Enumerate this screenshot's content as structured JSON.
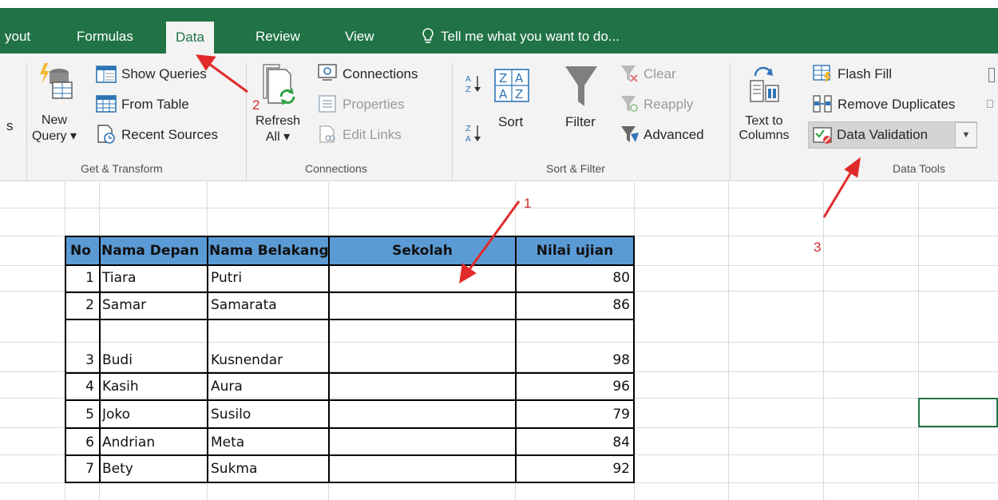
{
  "tabs": [
    {
      "label": "yout",
      "active": false
    },
    {
      "label": "Formulas",
      "active": false
    },
    {
      "label": "Data",
      "active": true
    },
    {
      "label": "Review",
      "active": false
    },
    {
      "label": "View",
      "active": false
    }
  ],
  "tell_me": "Tell me what you want to do...",
  "ribbon": {
    "get_transform": {
      "label": "Get & Transform",
      "partial_label": "s",
      "new_query": [
        "New",
        "Query"
      ],
      "show_queries": "Show Queries",
      "from_table": "From Table",
      "recent_sources": "Recent Sources"
    },
    "connections": {
      "label": "Connections",
      "refresh_all": [
        "Refresh",
        "All"
      ],
      "connections": "Connections",
      "properties": "Properties",
      "edit_links": "Edit Links"
    },
    "sort_filter": {
      "label": "Sort & Filter",
      "sort": "Sort",
      "filter": "Filter",
      "clear": "Clear",
      "reapply": "Reapply",
      "advanced": "Advanced"
    },
    "data_tools": {
      "label": "Data Tools",
      "text_to_columns": [
        "Text to",
        "Columns"
      ],
      "flash_fill": "Flash Fill",
      "remove_duplicates": "Remove Duplicates",
      "data_validation": "Data Validation"
    }
  },
  "table": {
    "headers": [
      "No",
      "Nama Depan",
      "Nama Belakang",
      "Sekolah",
      "Nilai ujian"
    ],
    "rows": [
      [
        "1",
        "Tiara",
        "Putri",
        "",
        "80"
      ],
      [
        "2",
        "Samar",
        "Samarata",
        "",
        "86"
      ],
      [
        "3",
        "Budi",
        "Kusnendar",
        "",
        "98"
      ],
      [
        "4",
        "Kasih",
        "Aura",
        "",
        "96"
      ],
      [
        "5",
        "Joko",
        "Susilo",
        "",
        "79"
      ],
      [
        "6",
        "Andrian",
        "Meta",
        "",
        "84"
      ],
      [
        "7",
        "Bety",
        "Sukma",
        "",
        "92"
      ]
    ]
  },
  "annotations": [
    "1",
    "2",
    "3"
  ],
  "colors": {
    "ribbon_green": "#217346",
    "header_blue": "#5b9bd5",
    "annotation_red": "#d12f2f"
  }
}
